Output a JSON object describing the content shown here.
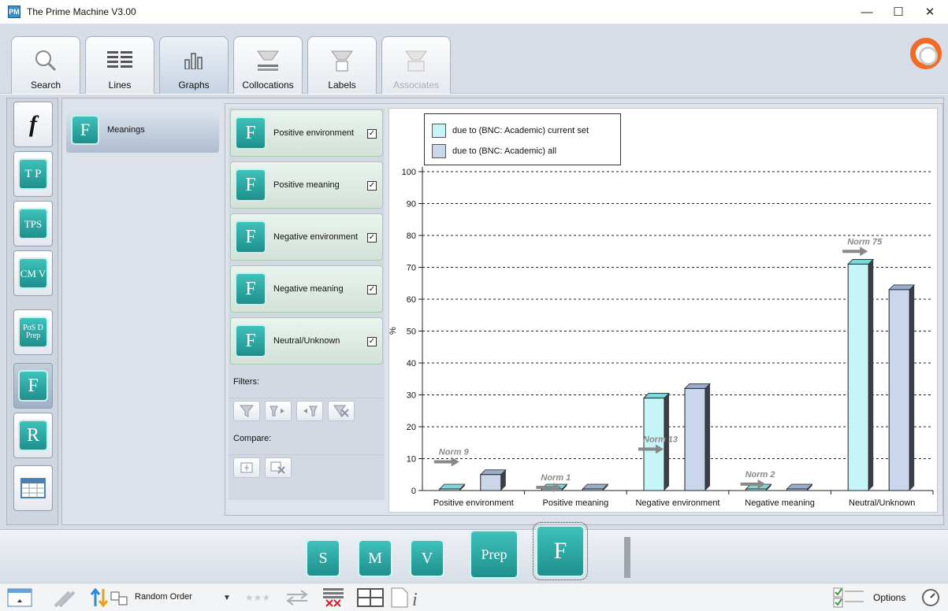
{
  "window": {
    "title": "The Prime Machine V3.00",
    "minimize_glyph": "—",
    "maximize_glyph": "☐",
    "close_glyph": "✕"
  },
  "tabs": [
    {
      "label": "Search",
      "icon": "magnifier-icon"
    },
    {
      "label": "Lines",
      "icon": "lines-icon"
    },
    {
      "label": "Graphs",
      "icon": "bar-graph-icon",
      "active": true
    },
    {
      "label": "Collocations",
      "icon": "word-cloud-icon"
    },
    {
      "label": "Labels",
      "icon": "labels-icon"
    },
    {
      "label": "Associates",
      "icon": "associates-icon",
      "disabled": true
    }
  ],
  "side_buttons": [
    {
      "glyph": "f",
      "name": "function-words"
    },
    {
      "glyph": "T P",
      "name": "text-position"
    },
    {
      "glyph": "TPS",
      "name": "text-position-sentence"
    },
    {
      "glyph": "CM V",
      "name": "collocation-metadata"
    },
    {
      "glyph": "PoS D Prep",
      "name": "part-of-speech"
    },
    {
      "glyph": "F",
      "name": "meanings",
      "active": true
    },
    {
      "glyph": "R",
      "name": "related"
    },
    {
      "glyph": "",
      "name": "table-view"
    }
  ],
  "meanings_tab": {
    "label": "Meanings",
    "glyph": "F"
  },
  "categories": [
    {
      "label": "Positive environment",
      "checked": true
    },
    {
      "label": "Positive meaning",
      "checked": true
    },
    {
      "label": "Negative environment",
      "checked": true
    },
    {
      "label": "Negative meaning",
      "checked": true
    },
    {
      "label": "Neutral/Unknown",
      "checked": true
    }
  ],
  "check_glyph": "✓",
  "filters_label": "Filters:",
  "compare_label": "Compare:",
  "chart_data": {
    "type": "bar",
    "categories": [
      "Positive environment",
      "Positive meaning",
      "Negative environment",
      "Negative meaning",
      "Neutral/Unknown"
    ],
    "series": [
      {
        "name": "due to (BNC: Academic) current set",
        "values": [
          0.5,
          0.5,
          29,
          0.5,
          71
        ],
        "color": "#c6f5f7"
      },
      {
        "name": "due to (BNC: Academic) all",
        "values": [
          5,
          0.5,
          32,
          0.5,
          63
        ],
        "color": "#c9d6ec"
      }
    ],
    "norms": [
      {
        "label": "Norm 9",
        "value": 9
      },
      {
        "label": "Norm 1",
        "value": 1
      },
      {
        "label": "Norm 13",
        "value": 13
      },
      {
        "label": "Norm 2",
        "value": 2
      },
      {
        "label": "Norm 75",
        "value": 75
      }
    ],
    "ylabel": "%",
    "ylim": [
      0,
      100
    ],
    "yticks": [
      0,
      10,
      20,
      30,
      40,
      50,
      60,
      70,
      80,
      90,
      100
    ],
    "grid": true,
    "legend_position": "top-left"
  },
  "dock": [
    {
      "glyph": "S",
      "name": "sentence-button"
    },
    {
      "glyph": "M",
      "name": "metadata-button"
    },
    {
      "glyph": "V",
      "name": "verb-button"
    },
    {
      "glyph": "Prep",
      "name": "preposition-button"
    },
    {
      "glyph": "F",
      "name": "meanings-dock-button",
      "active": true
    }
  ],
  "statusbar": {
    "order_label": "Random Order",
    "options_label": "Options"
  }
}
